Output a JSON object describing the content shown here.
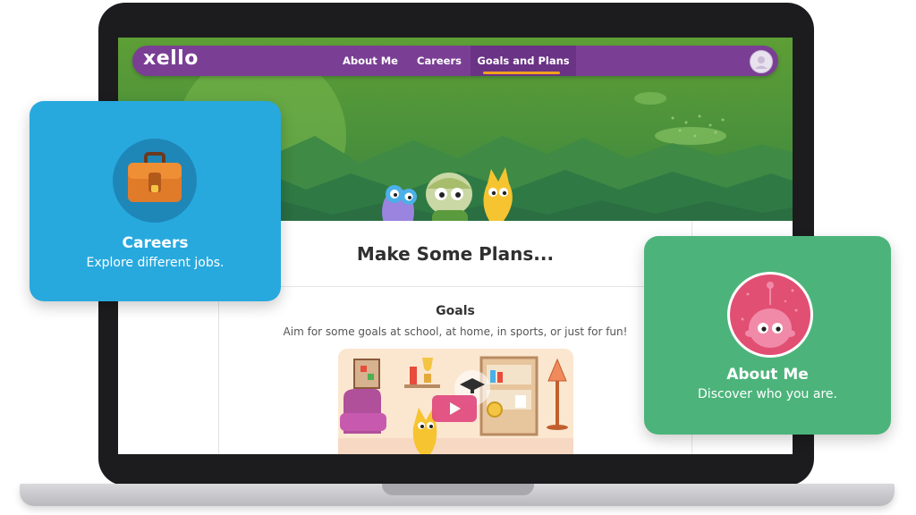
{
  "app": {
    "logo_text": "xello"
  },
  "nav": {
    "items": [
      {
        "label": "About Me"
      },
      {
        "label": "Careers"
      },
      {
        "label": "Goals and Plans"
      }
    ],
    "active_index": 2
  },
  "page": {
    "heading": "Make Some Plans...",
    "goals": {
      "title": "Goals",
      "description": "Aim for some goals at school, at home, in sports, or just for fun!"
    }
  },
  "cards": {
    "careers": {
      "title": "Careers",
      "subtitle": "Explore different jobs.",
      "icon": "briefcase-icon"
    },
    "about_me": {
      "title": "About Me",
      "subtitle": "Discover who you are.",
      "icon": "pink-character-icon"
    }
  },
  "colors": {
    "nav_bg": "#7a3f94",
    "nav_active_underline": "#f3a21b",
    "careers_card": "#27a9de",
    "about_card": "#4cb47b",
    "hero_green": "#4a913b"
  }
}
